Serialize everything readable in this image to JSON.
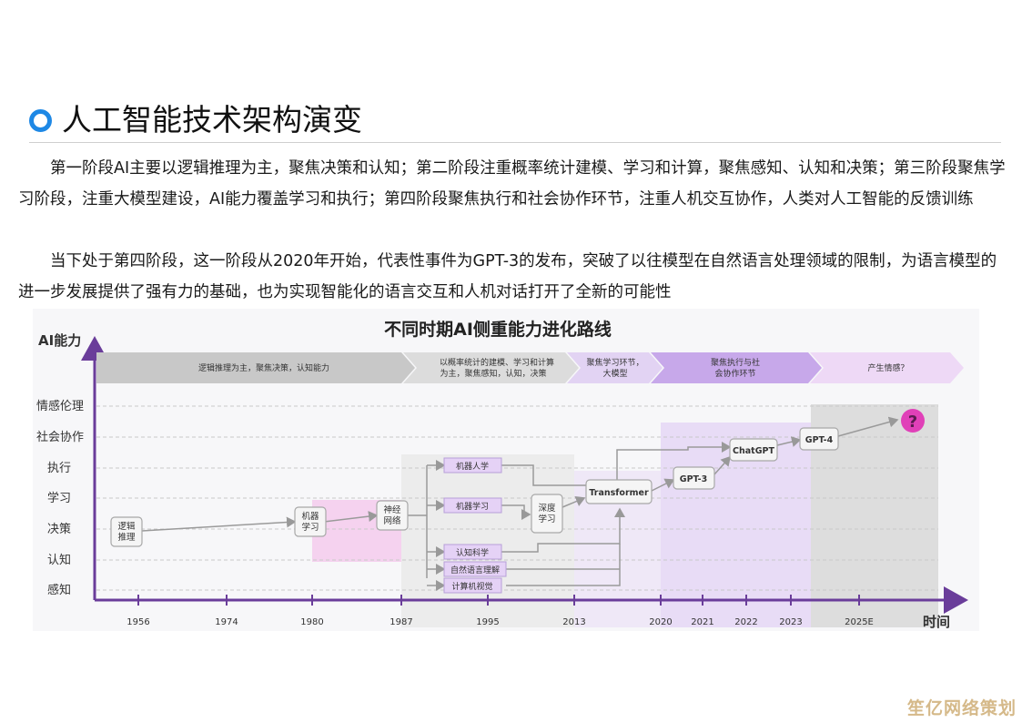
{
  "page": {
    "title": "人工智能技术架构演变",
    "paragraph1": "第一阶段AI主要以逻辑推理为主，聚焦决策和认知；第二阶段注重概率统计建模、学习和计算，聚焦感知、认知和决策；第三阶段聚焦学习阶段，注重大模型建设，AI能力覆盖学习和执行；第四阶段聚焦执行和社会协作环节，注重人机交互协作，人类对人工智能的反馈训练",
    "paragraph2": "当下处于第四阶段，这一阶段从2020年开始，代表性事件为GPT-3的发布，突破了以往模型在自然语言处理领域的限制，为语言模型的进一步发展提供了强有力的基础，也为实现智能化的语言交互和人机对话打开了全新的可能性"
  },
  "figure": {
    "title": "不同时期AI侧重能力进化路线",
    "y_axis_label": "AI能力",
    "x_axis_label": "时间",
    "y_levels": [
      "情感伦理",
      "社会协作",
      "执行",
      "学习",
      "决策",
      "认知",
      "感知"
    ],
    "x_ticks": [
      "1956",
      "1974",
      "1980",
      "1987",
      "1995",
      "2013",
      "2020",
      "2021",
      "2022",
      "2023",
      "2025E"
    ],
    "stages": [
      {
        "line1": "逻辑推理为主，聚焦决策，认知能力",
        "line2": ""
      },
      {
        "line1": "以概率统计的建模、学习和计算",
        "line2": "为主，聚焦感知，认知，决策"
      },
      {
        "line1": "聚焦学习环节，",
        "line2": "大模型"
      },
      {
        "line1": "聚焦执行与社",
        "line2": "会协作环节"
      },
      {
        "line1": "产生情感？",
        "line2": ""
      }
    ],
    "nodes": {
      "logic": [
        "逻辑",
        "推理"
      ],
      "ml": [
        "机器",
        "学习"
      ],
      "nn": [
        "神经",
        "网络"
      ],
      "deep": [
        "深度",
        "学习"
      ],
      "transformer": "Transformer",
      "gpt3": "GPT-3",
      "chatgpt": "ChatGPT",
      "gpt4": "GPT-4",
      "question": "?"
    },
    "branches": [
      "机器人学",
      "机器学习",
      "认知科学",
      "自然语言理解",
      "计算机视觉"
    ],
    "colors": {
      "axis": "#6a3d9a",
      "stage1": "#c8c8c8",
      "stage2": "#dcdcdc",
      "stage3": "#e2d3f3",
      "stage4": "#c7a8ea",
      "stage5": "#eed9f6",
      "question": "#e040b8"
    }
  },
  "watermark_brand": "笙亿网络策划"
}
